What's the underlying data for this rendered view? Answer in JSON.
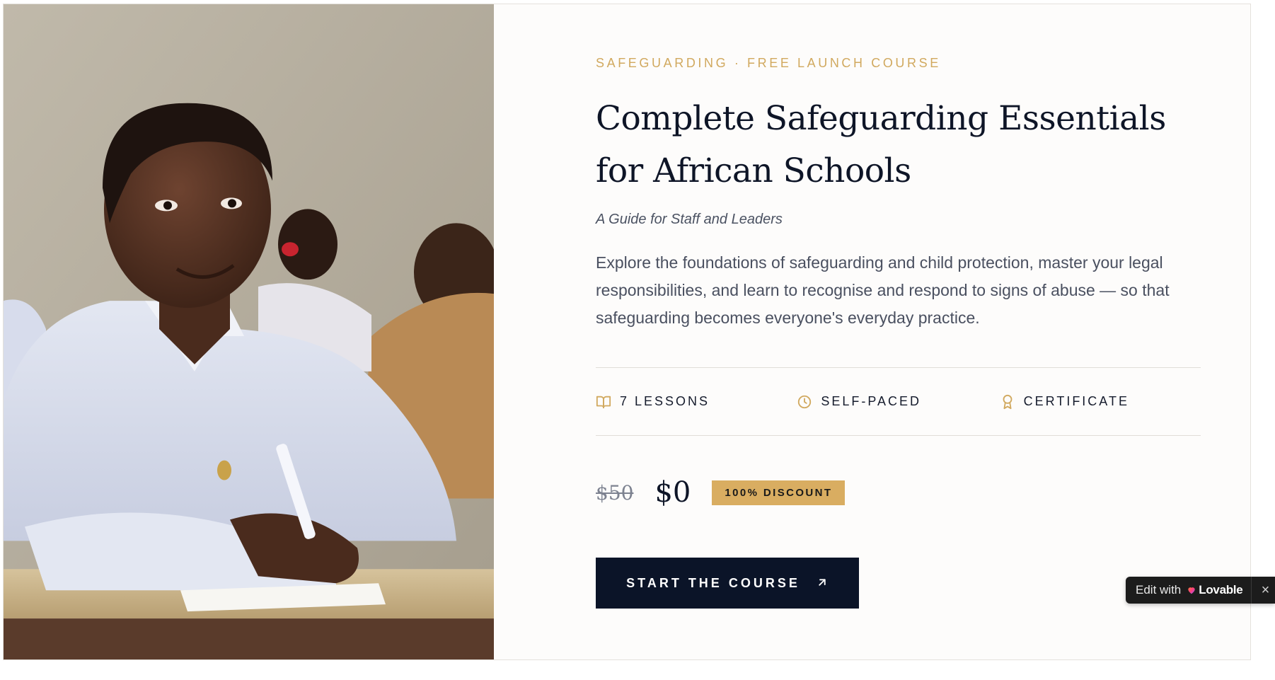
{
  "course": {
    "eyebrow": "SAFEGUARDING · FREE LAUNCH COURSE",
    "title": "Complete Safeguarding Essentials for African Schools",
    "subtitle": "A Guide for Staff and Leaders",
    "description": "Explore the foundations of safeguarding and child protection, master your legal responsibilities, and learn to recognise and respond to signs of abuse — so that safeguarding becomes everyone's everyday practice."
  },
  "features": [
    {
      "icon": "book-open-icon",
      "label": "7 LESSONS"
    },
    {
      "icon": "clock-icon",
      "label": "SELF-PACED"
    },
    {
      "icon": "award-icon",
      "label": "CERTIFICATE"
    }
  ],
  "pricing": {
    "old_price": "$50",
    "new_price": "$0",
    "discount": "100% DISCOUNT"
  },
  "cta": {
    "label": "START THE COURSE",
    "icon": "arrow-up-right-icon"
  },
  "lovable_badge": {
    "prefix": "Edit with",
    "brand": "Lovable",
    "close_icon": "close-icon"
  },
  "colors": {
    "accent_gold": "#d1a95f",
    "badge_gold": "#d9ad61",
    "navy": "#0b1428",
    "text_dark": "#0e1527",
    "text_muted": "#4a5060"
  }
}
